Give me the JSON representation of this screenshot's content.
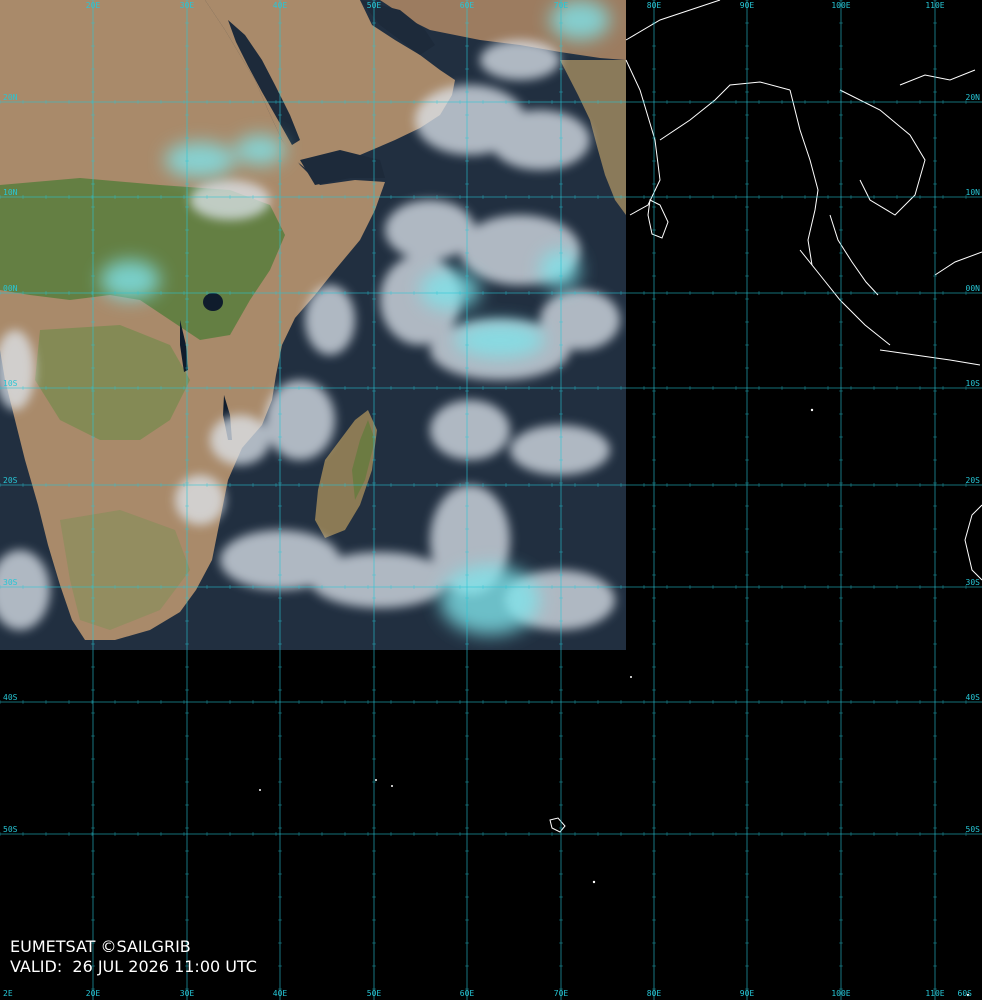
{
  "caption": {
    "credit": "EUMETSAT ©SAILGRIB",
    "valid": "VALID:  26 JUL 2026 11:00 UTC"
  },
  "grid": {
    "line_color": "#27c6d6",
    "longitude_labels": [
      "20E",
      "30E",
      "40E",
      "50E",
      "60E",
      "70E",
      "80E",
      "90E",
      "100E",
      "110E"
    ],
    "latitude_labels": [
      "20N",
      "10N",
      "00N",
      "10S",
      "20S",
      "30S",
      "40S",
      "50S"
    ],
    "corner_labels": [
      "60S",
      "2E"
    ]
  },
  "colors": {
    "ocean": "#1d2a3a",
    "land_arid": "#a98a6a",
    "land_vegetation": "#587c3c",
    "cloud_white": "#dfe6ee",
    "cloud_cyan": "#7fe3ea",
    "coastline": "#ffffff",
    "background": "#000000"
  }
}
